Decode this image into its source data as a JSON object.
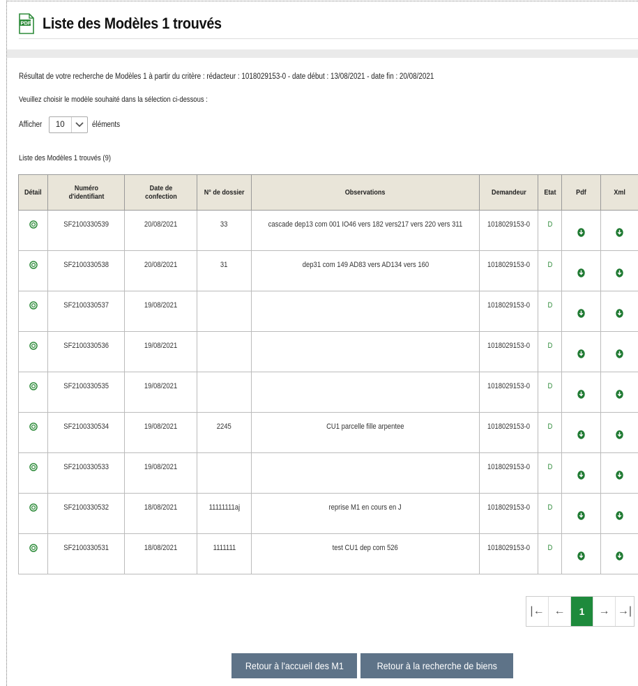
{
  "header": {
    "title": "Liste des Modèles 1 trouvés",
    "icon": "pdf-document-icon"
  },
  "intro": {
    "criteria_text": "Résultat de votre recherche de Modèles 1 à partir du critère : rédacteur : 1018029153-0 - date début : 13/08/2021 - date fin : 20/08/2021",
    "instruction_text": "Veuillez choisir le modèle souhaité dans la sélection ci-dessous :"
  },
  "page_size": {
    "prefix": "Afficher",
    "value": "10",
    "suffix": "éléments"
  },
  "list": {
    "caption": "Liste des Modèles 1 trouvés (9)",
    "columns": [
      "Détail",
      "Numéro d'identifiant",
      "Date de confection",
      "N° de dossier",
      "Observations",
      "Demandeur",
      "Etat",
      "Pdf",
      "Xml"
    ],
    "rows": [
      {
        "id": "SF2100330539",
        "date": "20/08/2021",
        "dossier": "33",
        "observations": "cascade dep13 com 001 IO46 vers 182 vers217 vers 220 vers 311",
        "demandeur": "1018029153-0",
        "etat": "D"
      },
      {
        "id": "SF2100330538",
        "date": "20/08/2021",
        "dossier": "31",
        "observations": "dep31 com 149 AD83 vers AD134 vers 160",
        "demandeur": "1018029153-0",
        "etat": "D"
      },
      {
        "id": "SF2100330537",
        "date": "19/08/2021",
        "dossier": "",
        "observations": "",
        "demandeur": "1018029153-0",
        "etat": "D"
      },
      {
        "id": "SF2100330536",
        "date": "19/08/2021",
        "dossier": "",
        "observations": "",
        "demandeur": "1018029153-0",
        "etat": "D"
      },
      {
        "id": "SF2100330535",
        "date": "19/08/2021",
        "dossier": "",
        "observations": "",
        "demandeur": "1018029153-0",
        "etat": "D"
      },
      {
        "id": "SF2100330534",
        "date": "19/08/2021",
        "dossier": "2245",
        "observations": "CU1 parcelle fille arpentee",
        "demandeur": "1018029153-0",
        "etat": "D"
      },
      {
        "id": "SF2100330533",
        "date": "19/08/2021",
        "dossier": "",
        "observations": "",
        "demandeur": "1018029153-0",
        "etat": "D"
      },
      {
        "id": "SF2100330532",
        "date": "18/08/2021",
        "dossier": "11111111aj",
        "observations": "reprise M1 en cours en J",
        "demandeur": "1018029153-0",
        "etat": "D"
      },
      {
        "id": "SF2100330531",
        "date": "18/08/2021",
        "dossier": "1111111",
        "observations": "test CU1 dep com 526",
        "demandeur": "1018029153-0",
        "etat": "D"
      }
    ]
  },
  "pagination": {
    "first": "|←",
    "prev": "←",
    "current": "1",
    "next": "→",
    "last": "→|"
  },
  "buttons": {
    "home_m1": "Retour à l'accueil des M1",
    "search_goods": "Retour à la recherche de biens"
  },
  "colors": {
    "accent_green": "#1e8a3c",
    "header_bg": "#e9e5d9",
    "button_bg": "#5e7388"
  }
}
